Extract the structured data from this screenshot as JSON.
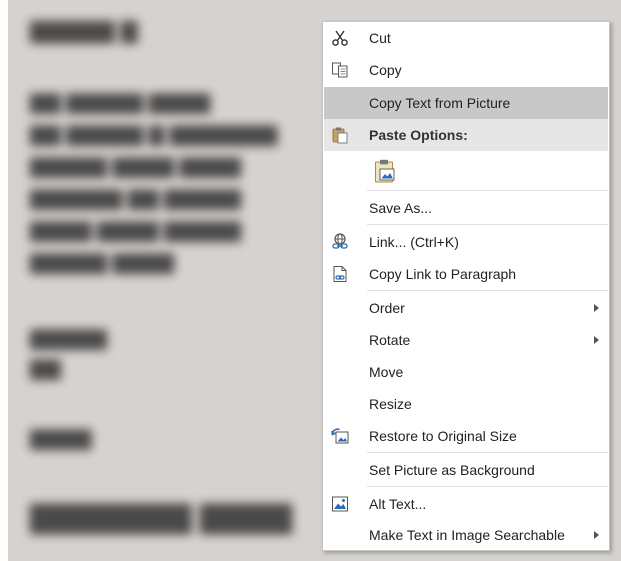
{
  "menu": {
    "cut": {
      "label": "Cut",
      "icon": "scissors-icon"
    },
    "copy": {
      "label": "Copy",
      "icon": "copy-icon"
    },
    "copy_text": {
      "label": "Copy Text from Picture"
    },
    "paste_options": {
      "label": "Paste Options:",
      "icon": "paste-icon"
    },
    "paste_picture": {
      "icon": "paste-picture-icon"
    },
    "save_as": {
      "label": "Save As..."
    },
    "link": {
      "label": "Link... (Ctrl+K)",
      "icon": "link-icon"
    },
    "copy_link": {
      "label": "Copy Link to Paragraph",
      "icon": "paragraph-link-icon"
    },
    "order": {
      "label": "Order"
    },
    "rotate": {
      "label": "Rotate"
    },
    "move": {
      "label": "Move"
    },
    "resize": {
      "label": "Resize"
    },
    "restore": {
      "label": "Restore to Original Size",
      "icon": "restore-size-icon"
    },
    "set_background": {
      "label": "Set Picture as Background"
    },
    "alt_text": {
      "label": "Alt Text...",
      "icon": "alt-text-icon"
    },
    "searchable": {
      "label": "Make Text in Image Searchable"
    }
  },
  "colors": {
    "menu_bg": "#ffffff",
    "highlight": "#c8c8c8",
    "section_header": "#e6e6e6",
    "icon_blue": "#2b6cb0"
  }
}
